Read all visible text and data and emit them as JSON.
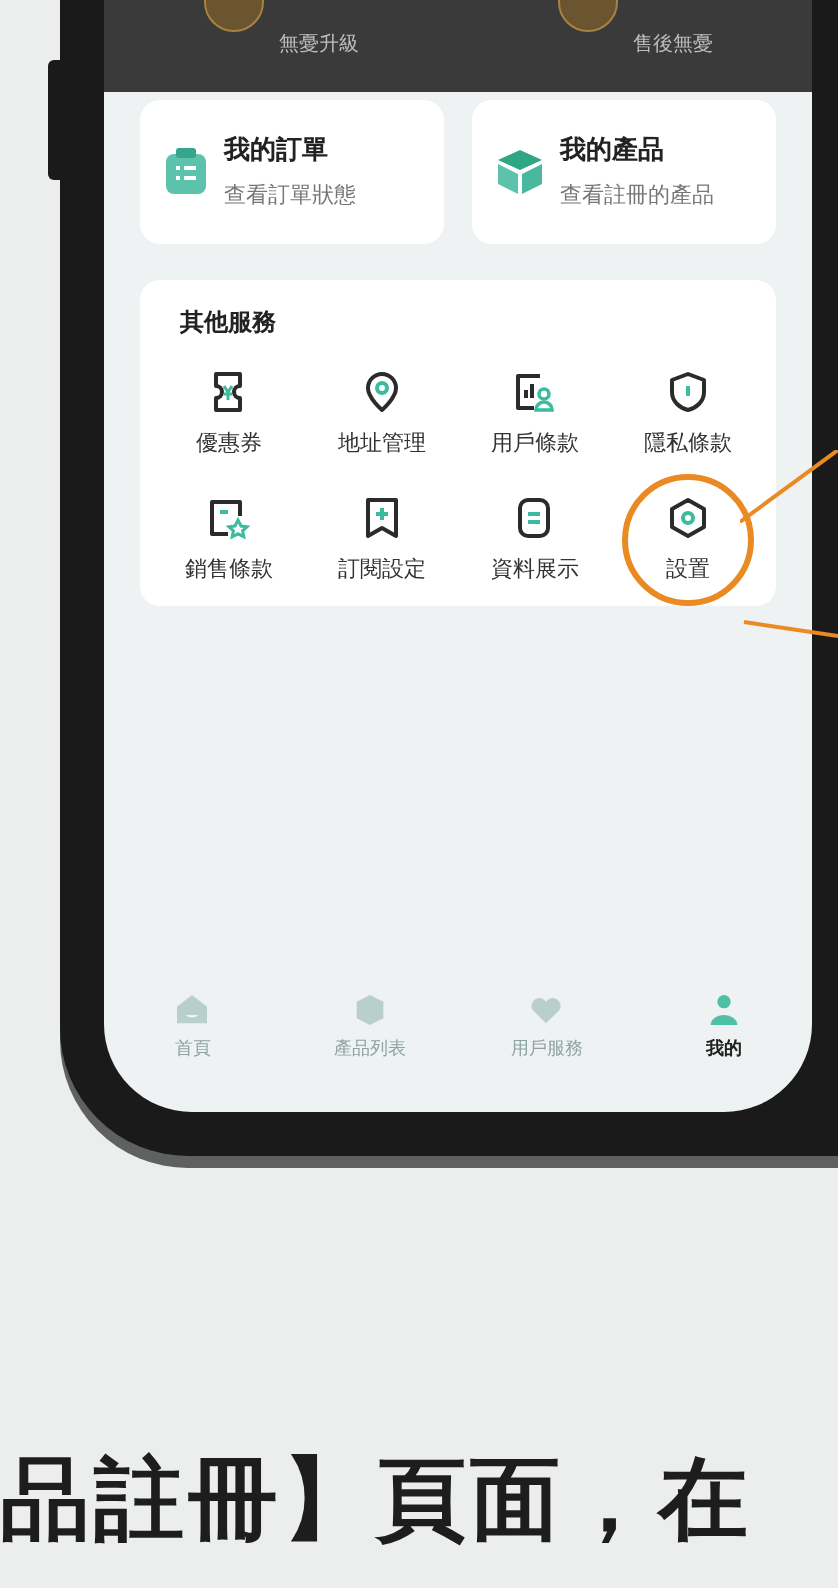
{
  "header": {
    "items": [
      {
        "label": "無憂升級"
      },
      {
        "label": "售後無憂"
      }
    ]
  },
  "cards": [
    {
      "kind": "clipboard",
      "title": "我的訂單",
      "subtitle": "查看訂單狀態"
    },
    {
      "kind": "cube",
      "title": "我的產品",
      "subtitle": "查看註冊的產品"
    }
  ],
  "services": {
    "title": "其他服務",
    "items": [
      {
        "kind": "ticket",
        "label": "優惠券",
        "highlighted": false
      },
      {
        "kind": "pin",
        "label": "地址管理",
        "highlighted": false
      },
      {
        "kind": "chart-user",
        "label": "用戶條款",
        "highlighted": false
      },
      {
        "kind": "shield",
        "label": "隱私條款",
        "highlighted": false
      },
      {
        "kind": "doc-star",
        "label": "銷售條款",
        "highlighted": false
      },
      {
        "kind": "bookmark-plus",
        "label": "訂閱設定",
        "highlighted": false
      },
      {
        "kind": "doc-lines",
        "label": "資料展示",
        "highlighted": false
      },
      {
        "kind": "hexagon",
        "label": "設置",
        "highlighted": true
      }
    ]
  },
  "tab_bar": [
    {
      "kind": "home",
      "label": "首頁",
      "selected": false
    },
    {
      "kind": "cube",
      "label": "產品列表",
      "selected": false
    },
    {
      "kind": "heart",
      "label": "用戶服務",
      "selected": false
    },
    {
      "kind": "person",
      "label": "我的",
      "selected": true
    }
  ],
  "caption": "品註冊】頁面，在"
}
